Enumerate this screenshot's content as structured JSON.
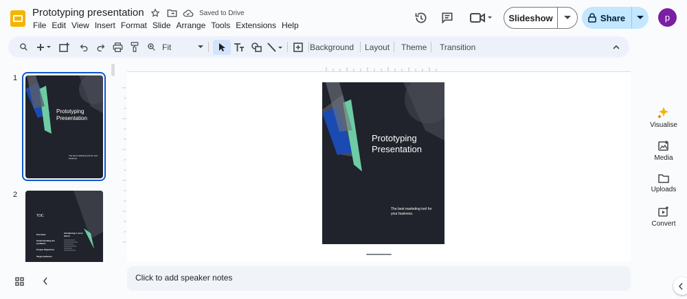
{
  "app": {
    "title": "Prototyping presentation",
    "saved_status": "Saved to Drive",
    "user_initial": "p"
  },
  "menu": [
    "File",
    "Edit",
    "View",
    "Insert",
    "Format",
    "Slide",
    "Arrange",
    "Tools",
    "Extensions",
    "Help"
  ],
  "header": {
    "slideshow_label": "Slideshow",
    "share_label": "Share"
  },
  "toolbar": {
    "zoom_value": "Fit",
    "background": "Background",
    "layout": "Layout",
    "theme": "Theme",
    "transition": "Transition"
  },
  "filmstrip": {
    "slides": [
      {
        "number": "1",
        "title": "Prototyping Presentation",
        "subtitle": "The best marketing tool for your business."
      },
      {
        "number": "2",
        "heading": "TOC",
        "col1": [
          "Overview",
          "Understanding the problems",
          "Project Objectives",
          "Target audience"
        ],
        "col2_title": "Introducing: Lorem Ipsum"
      }
    ]
  },
  "slide": {
    "title": "Prototyping Presentation",
    "subtitle": "The best marketing tool for your business."
  },
  "notes": {
    "placeholder": "Click to add speaker notes"
  },
  "side_panel": [
    {
      "label": "Visualise",
      "icon": "sparkle-icon"
    },
    {
      "label": "Media",
      "icon": "media-icon"
    },
    {
      "label": "Uploads",
      "icon": "folder-icon"
    },
    {
      "label": "Convert",
      "icon": "convert-icon"
    }
  ],
  "colors": {
    "accent_green": "#6dcca4",
    "accent_blue": "#1b4ab3",
    "slide_bg": "#20232b",
    "share_bg": "#c2e7ff",
    "avatar_bg": "#7b1fa2"
  }
}
